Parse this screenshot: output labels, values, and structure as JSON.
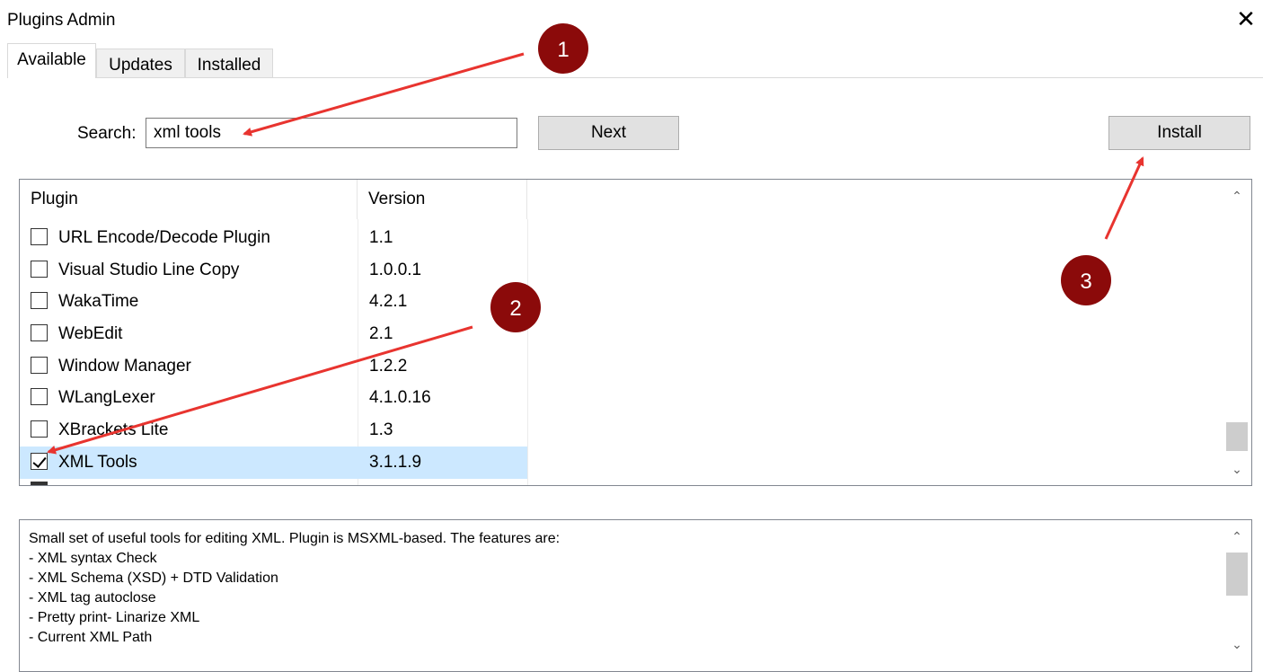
{
  "window": {
    "title": "Plugins Admin",
    "close_glyph": "✕"
  },
  "tabs": [
    {
      "label": "Available",
      "active": true
    },
    {
      "label": "Updates",
      "active": false
    },
    {
      "label": "Installed",
      "active": false
    }
  ],
  "search": {
    "label": "Search:",
    "value": "xml tools"
  },
  "buttons": {
    "next": "Next",
    "install": "Install"
  },
  "plugin_list": {
    "columns": [
      "Plugin",
      "Version"
    ],
    "rows": [
      {
        "name": "URL Encode/Decode Plugin",
        "version": "1.1",
        "checked": false
      },
      {
        "name": "Visual Studio Line Copy",
        "version": "1.0.0.1",
        "checked": false
      },
      {
        "name": "WakaTime",
        "version": "4.2.1",
        "checked": false
      },
      {
        "name": "WebEdit",
        "version": "2.1",
        "checked": false
      },
      {
        "name": "Window Manager",
        "version": "1.2.2",
        "checked": false
      },
      {
        "name": "WLangLexer",
        "version": "4.1.0.16",
        "checked": false
      },
      {
        "name": "XBrackets Lite",
        "version": "1.3",
        "checked": false
      },
      {
        "name": "XML Tools",
        "version": "3.1.1.9",
        "checked": true,
        "selected": true
      }
    ]
  },
  "description": {
    "lines": [
      "Small set of useful tools for editing XML. Plugin is MSXML-based. The features are:",
      "- XML syntax Check",
      "- XML Schema (XSD) + DTD Validation",
      "- XML tag autoclose",
      "- Pretty print- Linarize XML",
      "- Current XML Path"
    ]
  },
  "annotations": [
    {
      "number": "1"
    },
    {
      "number": "2"
    },
    {
      "number": "3"
    }
  ],
  "colors": {
    "badge": "#8b0a0a",
    "arrow": "#e8342f",
    "selection": "#cce8ff"
  },
  "icons": {
    "scroll_up": "chevron-up-icon",
    "scroll_down": "chevron-down-icon",
    "close": "close-icon"
  }
}
